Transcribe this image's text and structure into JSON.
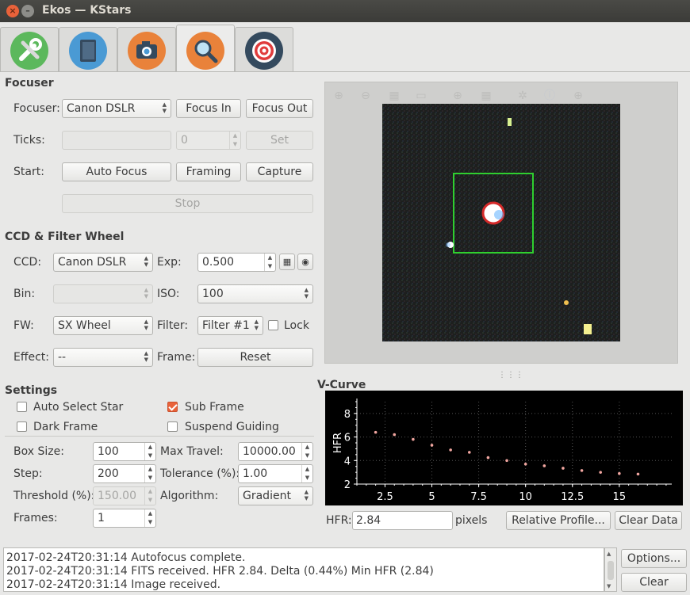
{
  "window": {
    "title": "Ekos — KStars"
  },
  "tabs": [
    {
      "name": "setup",
      "icon": "wrench-screwdriver-icon"
    },
    {
      "name": "scheduler",
      "icon": "notebook-icon"
    },
    {
      "name": "capture",
      "icon": "camera-icon"
    },
    {
      "name": "focus",
      "icon": "magnifier-icon"
    },
    {
      "name": "align",
      "icon": "target-icon"
    }
  ],
  "focuser": {
    "section": "Focuser",
    "focuser_label": "Focuser:",
    "focuser_value": "Canon DSLR",
    "focus_in": "Focus In",
    "focus_out": "Focus Out",
    "ticks_label": "Ticks:",
    "ticks_value": "0",
    "set": "Set",
    "start_label": "Start:",
    "auto_focus": "Auto Focus",
    "framing": "Framing",
    "capture": "Capture",
    "stop": "Stop"
  },
  "ccd": {
    "section": "CCD & Filter Wheel",
    "ccd_label": "CCD:",
    "ccd_value": "Canon DSLR",
    "exp_label": "Exp:",
    "exp_value": "0.500",
    "bin_label": "Bin:",
    "iso_label": "ISO:",
    "iso_value": "100",
    "fw_label": "FW:",
    "fw_value": "SX Wheel",
    "filter_label": "Filter:",
    "filter_value": "Filter #1",
    "lock": "Lock",
    "effect_label": "Effect:",
    "effect_value": "--",
    "frame_label": "Frame:",
    "reset": "Reset"
  },
  "settings": {
    "section": "Settings",
    "auto_select_star": "Auto Select Star",
    "sub_frame": "Sub Frame",
    "dark_frame": "Dark Frame",
    "suspend_guiding": "Suspend Guiding",
    "box_size_label": "Box Size:",
    "box_size": "100",
    "max_travel_label": "Max Travel:",
    "max_travel": "10000.00",
    "step_label": "Step:",
    "step": "200",
    "tolerance_label": "Tolerance (%):",
    "tolerance": "1.00",
    "threshold_label": "Threshold (%):",
    "threshold": "150.00",
    "algorithm_label": "Algorithm:",
    "algorithm": "Gradient",
    "frames_label": "Frames:",
    "frames": "1"
  },
  "vcurve": {
    "section": "V-Curve",
    "hfr_label": "HFR:",
    "hfr_value": "2.84",
    "pixels": "pixels",
    "relative_profile": "Relative Profile...",
    "clear_data": "Clear Data"
  },
  "chart_data": {
    "type": "scatter",
    "ylabel": "HFR",
    "xlabel": "",
    "xlim": [
      1,
      17.8
    ],
    "ylim": [
      2,
      9
    ],
    "xticks": [
      "2.5",
      "5",
      "7.5",
      "10",
      "12.5",
      "15"
    ],
    "xtick_values": [
      2.5,
      5,
      7.5,
      10,
      12.5,
      15
    ],
    "yticks": [
      "2",
      "4",
      "6",
      "8"
    ],
    "ytick_values": [
      2,
      4,
      6,
      8
    ],
    "x": [
      2,
      3,
      4,
      5,
      6,
      7,
      8,
      9,
      10,
      11,
      12,
      13,
      14,
      15,
      16
    ],
    "y": [
      6.4,
      6.2,
      5.8,
      5.3,
      4.9,
      4.7,
      4.25,
      4.0,
      3.7,
      3.55,
      3.35,
      3.15,
      3.0,
      2.9,
      2.85
    ],
    "grid": true,
    "point_color": "#f2a6a0"
  },
  "log": {
    "lines": [
      "2017-02-24T20:31:14 Autofocus complete.",
      "2017-02-24T20:31:14 FITS received. HFR 2.84. Delta (0.44%) Min HFR (2.84)",
      "2017-02-24T20:31:14 Image received."
    ],
    "options": "Options...",
    "clear": "Clear"
  },
  "colors": {
    "accent": "#e9623a",
    "selection_box": "#2fcf2f",
    "star_marker": "#e03030"
  }
}
